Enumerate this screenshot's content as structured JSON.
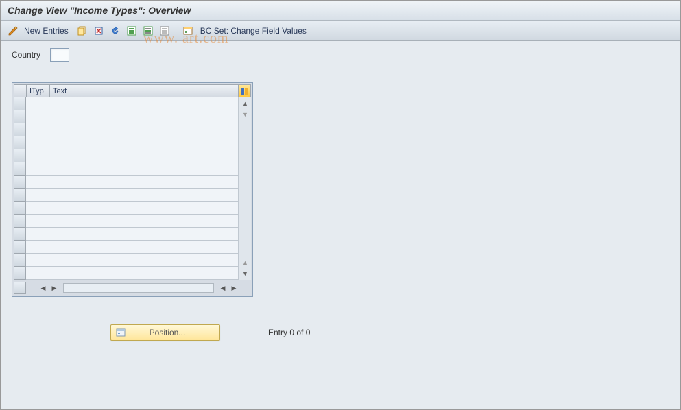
{
  "title": "Change View \"Income Types\": Overview",
  "toolbar": {
    "new_entries": "New Entries",
    "bc_set": "BC Set: Change Field Values"
  },
  "field": {
    "country_label": "Country",
    "country_value": ""
  },
  "table": {
    "columns": {
      "ityp": "ITyp",
      "text": "Text"
    },
    "rows": [
      {
        "ityp": "",
        "text": ""
      },
      {
        "ityp": "",
        "text": ""
      },
      {
        "ityp": "",
        "text": ""
      },
      {
        "ityp": "",
        "text": ""
      },
      {
        "ityp": "",
        "text": ""
      },
      {
        "ityp": "",
        "text": ""
      },
      {
        "ityp": "",
        "text": ""
      },
      {
        "ityp": "",
        "text": ""
      },
      {
        "ityp": "",
        "text": ""
      },
      {
        "ityp": "",
        "text": ""
      },
      {
        "ityp": "",
        "text": ""
      },
      {
        "ityp": "",
        "text": ""
      },
      {
        "ityp": "",
        "text": ""
      },
      {
        "ityp": "",
        "text": ""
      }
    ]
  },
  "footer": {
    "position_label": "Position...",
    "entry_text": "Entry 0 of 0"
  },
  "watermark": "www.                                     art.com"
}
